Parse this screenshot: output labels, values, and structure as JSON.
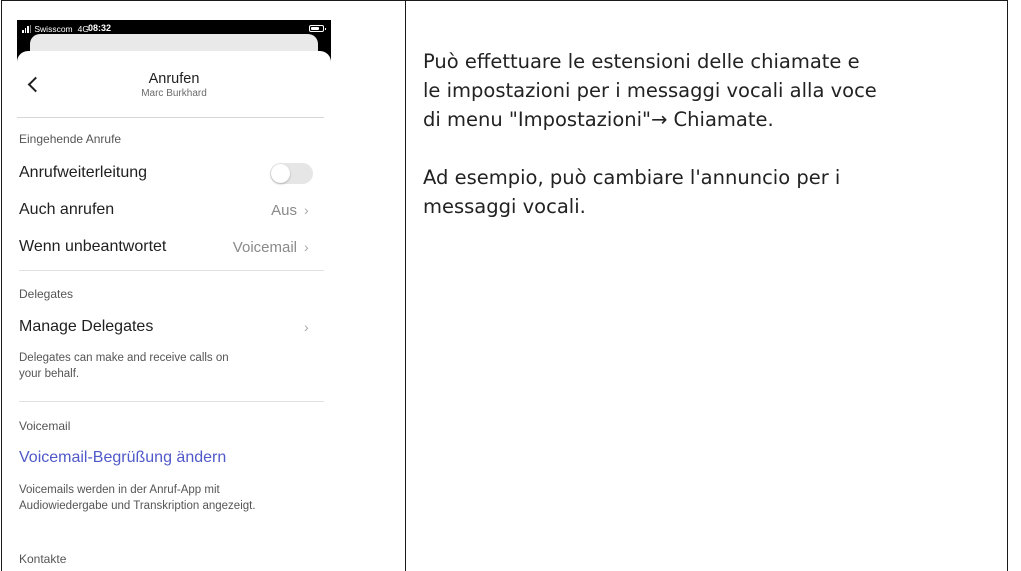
{
  "status_bar": {
    "carrier": "Swisscom",
    "network": "4G",
    "time": "08:32"
  },
  "nav": {
    "title": "Anrufen",
    "subtitle": "Marc Burkhard",
    "back_icon": "chevron-left-icon"
  },
  "sections": {
    "incoming": {
      "header": "Eingehende Anrufe",
      "forwarding_label": "Anrufweiterleitung",
      "forwarding_enabled": false,
      "also_ring_label": "Auch anrufen",
      "also_ring_value": "Aus",
      "unanswered_label": "Wenn unbeantwortet",
      "unanswered_value": "Voicemail"
    },
    "delegates": {
      "header": "Delegates",
      "manage_label": "Manage Delegates",
      "note_line1": "Delegates can make and receive calls on",
      "note_line2": "your behalf."
    },
    "voicemail": {
      "header": "Voicemail",
      "change_greeting_label": "Voicemail-Begrüßung ändern",
      "note_line1": "Voicemails werden in der Anruf-App mit",
      "note_line2": "Audiowiedergabe und Transkription angezeigt."
    },
    "contacts": {
      "header": "Kontakte"
    }
  },
  "description": {
    "line1": "Può effettuare le estensioni delle chiamate e",
    "line2": "le impostazioni per i messaggi vocali alla voce",
    "line3": "di menu \"Impostazioni\"→ Chiamate.",
    "line4": "Ad esempio, può cambiare l'annuncio per i",
    "line5": "messaggi vocali."
  },
  "colors": {
    "link": "#5059c9",
    "toggle_off": "#e6e6e6",
    "status_bar": "#000000"
  }
}
